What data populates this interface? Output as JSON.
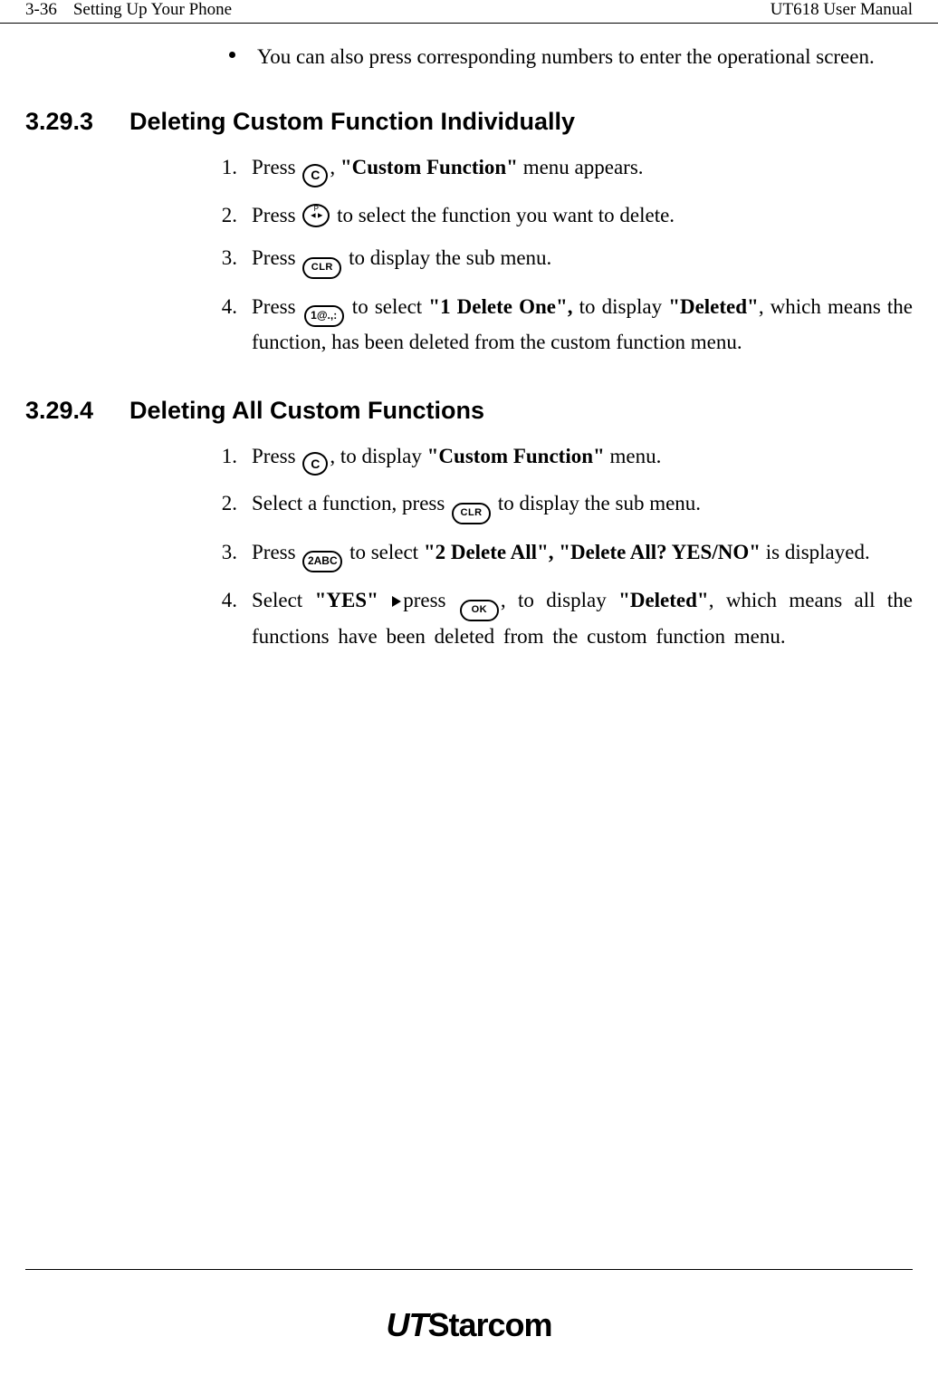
{
  "header": {
    "page_num": "3-36",
    "chapter": "Setting Up Your Phone",
    "manual": "UT618 User Manual"
  },
  "intro_bullet": "You can also press corresponding numbers to enter the operational screen.",
  "section1": {
    "number": "3.29.3",
    "title": "Deleting Custom Function Individually",
    "items": [
      {
        "n": "1.",
        "pre": "Press ",
        "icon": "c-circle",
        "post_a": ", ",
        "bold_a": "\"Custom Function\"",
        "post_b": " menu appears."
      },
      {
        "n": "2.",
        "pre": "Press ",
        "icon": "nav-circle",
        "post_a": " to select the function you want to delete."
      },
      {
        "n": "3.",
        "pre": "Press ",
        "icon": "clr-oval",
        "post_a": " to display the sub menu."
      },
      {
        "n": "4.",
        "pre": "Press ",
        "icon": "1-pill",
        "post_a": " to select ",
        "bold_a": "\"1 Delete One\",",
        "mid": " to display ",
        "bold_b": "\"Deleted\"",
        "post_b": ", which means the function, has been deleted from the custom function menu."
      }
    ]
  },
  "section2": {
    "number": "3.29.4",
    "title": "Deleting All Custom Functions",
    "items": [
      {
        "n": "1.",
        "pre": "Press ",
        "icon": "c-circle",
        "post_a": ", to display ",
        "bold_a": "\"Custom Function\"",
        "post_b": " menu."
      },
      {
        "n": "2.",
        "pre": "Select a function, press ",
        "icon": "clr-oval",
        "post_a": " to display the sub menu."
      },
      {
        "n": "3.",
        "pre": "Press ",
        "icon": "2-pill",
        "post_a": " to select ",
        "bold_a": "\"2 Delete All\", \"Delete All? YES/NO\"",
        "post_b": " is displayed."
      },
      {
        "n": "4.",
        "pre": "Select ",
        "bold_pre": "\"YES\"",
        "tri": true,
        "mid_pre": "press ",
        "icon": "ok-oval",
        "post_a": ", to display ",
        "bold_a": "\"Deleted\"",
        "post_b": ", which means all the functions have been deleted from the custom function menu."
      }
    ]
  },
  "footer": {
    "logo": "UTStarcom"
  },
  "icons": {
    "c-circle": "C",
    "clr-oval": "CLR",
    "ok-oval": "OK",
    "1-pill": "1@.,:",
    "2-pill": "2ABC"
  }
}
